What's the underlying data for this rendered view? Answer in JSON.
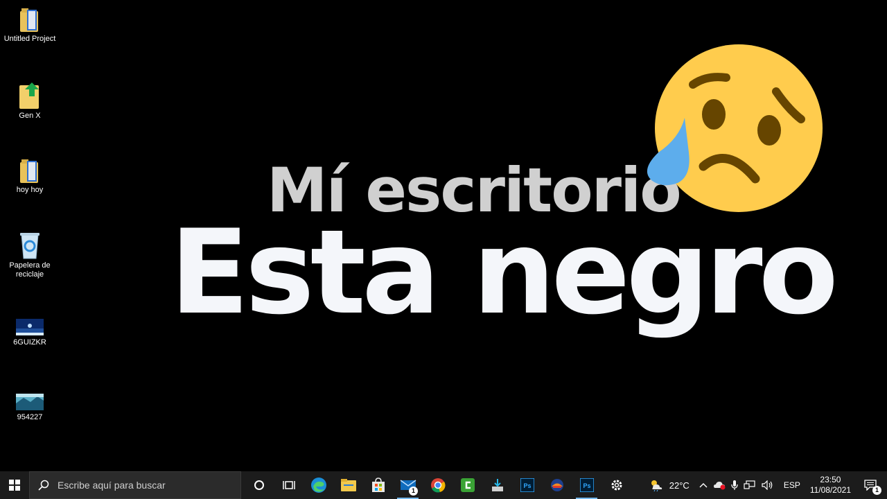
{
  "desktop": {
    "icons": [
      {
        "label": "Untitled Project"
      },
      {
        "label": "Gen X"
      },
      {
        "label": "hoy hoy"
      },
      {
        "label": "Papelera de reciclaje"
      },
      {
        "label": "6GUIZKR"
      },
      {
        "label": "954227"
      }
    ]
  },
  "overlay": {
    "line1": "Mí escritorio",
    "line2": "Esta negro"
  },
  "taskbar": {
    "search_placeholder": "Escribe aquí para buscar",
    "mail_badge": "1",
    "temperature": "22°C",
    "language": "ESP",
    "time": "23:50",
    "date": "11/08/2021",
    "notification_badge": "1"
  },
  "colors": {
    "desktop_bg": "#000000",
    "taskbar_bg": "#1c1c1c",
    "emoji_face": "#FFCC4D",
    "emoji_tear": "#5DADEC",
    "emoji_features": "#664500"
  },
  "icons": [
    "windows-logo-icon",
    "search-icon",
    "cortana-icon",
    "task-view-icon",
    "edge-icon",
    "file-explorer-icon",
    "store-icon",
    "mail-icon",
    "chrome-icon",
    "camtasia-icon",
    "installer-icon",
    "photoshop-icon",
    "app-icon",
    "photoshop-icon",
    "settings-icon",
    "weather-icon",
    "chevron-up-icon",
    "onedrive-icon",
    "microphone-icon",
    "network-icon",
    "volume-icon",
    "notification-icon"
  ]
}
